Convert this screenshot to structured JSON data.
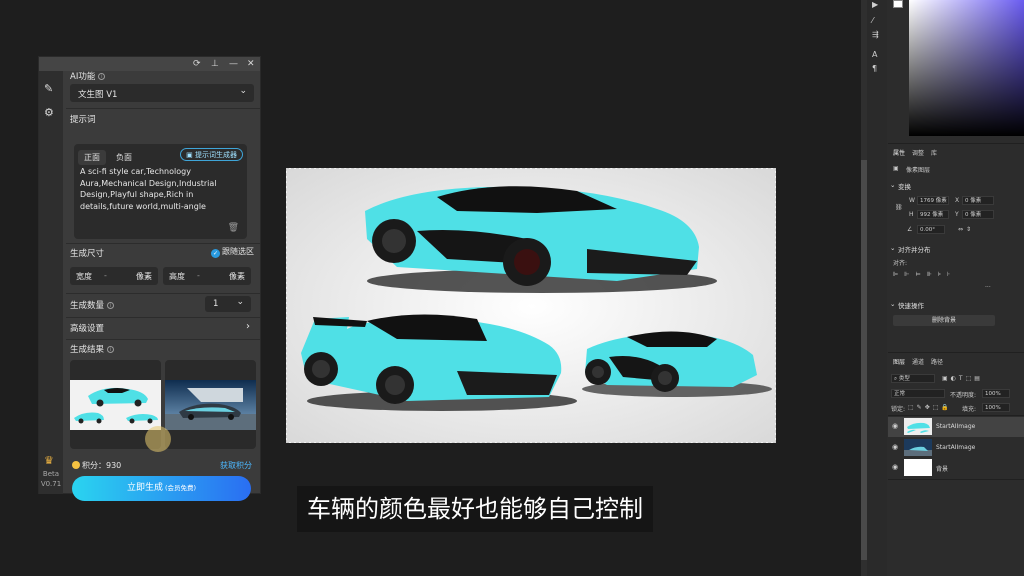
{
  "plugin": {
    "ai_function_label": "AI功能",
    "model_select": "文生图 V1",
    "prompt_label": "提示词",
    "tab_positive": "正面",
    "tab_negative": "负面",
    "prompt_generator_label": "提示词生成器",
    "prompt_text": "A sci-fi style car,Technology Aura,Mechanical Design,Industrial Design,Playful shape,Rich in details,future world,multi-angle",
    "size_label": "生成尺寸",
    "follow_selection_label": "跟随选区",
    "width_label": "宽度",
    "width_value": "-",
    "height_label": "高度",
    "height_value": "-",
    "pixel_unit": "像素",
    "count_label": "生成数量",
    "count_value": "1",
    "advanced_label": "高级设置",
    "results_label": "生成结果",
    "points_label": "积分：930",
    "get_points_label": "获取积分",
    "generate_button": "立即生成",
    "generate_sub": "(会员免费)",
    "beta_label": "Beta",
    "version_label": "V0.71"
  },
  "subtitle": "车辆的颜色最好也能够自己控制",
  "right_panel": {
    "tabs": [
      "属性",
      "调整",
      "库"
    ],
    "doc_layer_label": "像素图层",
    "transform_label": "变换",
    "w_value": "1769 像素",
    "h_value": "992 像素",
    "x_value": "0 像素",
    "y_value": "0 像素",
    "angle_value": "0.00°",
    "align_label": "对齐并分布",
    "align_sub": "对齐:",
    "quick_actions_label": "快速操作",
    "remove_bg_button": "删除背景",
    "layer_tabs": [
      "图层",
      "通道",
      "路径"
    ],
    "kind_label": "类型",
    "blend_mode": "正常",
    "opacity_label": "不透明度:",
    "opacity_value": "100%",
    "lock_label": "锁定:",
    "fill_label": "填充:",
    "fill_value": "100%",
    "layers": [
      "StartAIImage",
      "StartAIImage",
      "背景"
    ]
  },
  "colors": {
    "car": "#4fe0e6",
    "accent_blue": "#2a9be0",
    "button_start": "#2ad4f0",
    "button_end": "#2a6ef2"
  }
}
